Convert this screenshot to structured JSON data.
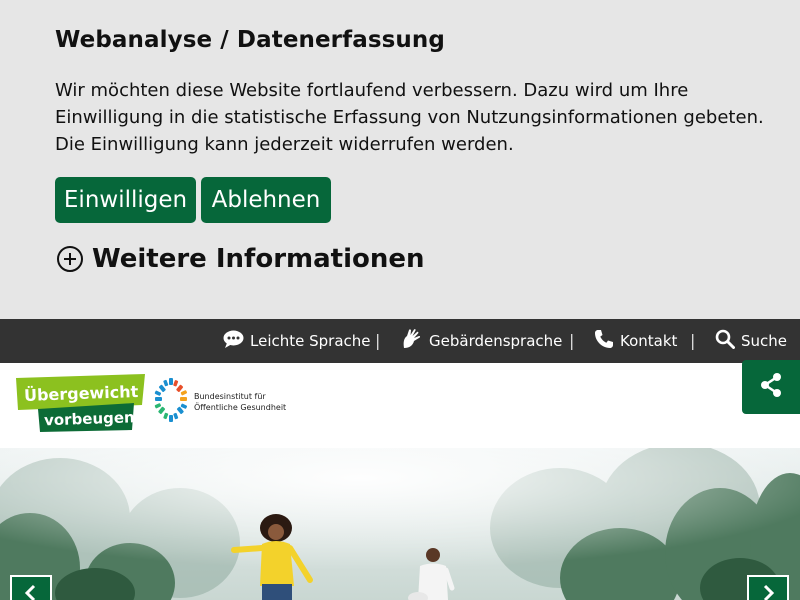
{
  "consent": {
    "title": "Webanalyse / Datenerfassung",
    "text_line1": "Wir möchten diese Website fortlaufend verbessern. Dazu wird um Ihre",
    "text_line2": "Einwilligung in die statistische Erfassung von Nutzungsinformationen gebeten.",
    "text_line3": "Die Einwilligung kann jederzeit widerrufen werden.",
    "accept_label": "Einwilligen",
    "decline_label": "Ablehnen",
    "more_info_label": "Weitere Informationen"
  },
  "utility_nav": {
    "easy_language": "Leichte Sprache",
    "sign_language": "Gebärdensprache",
    "contact": "Kontakt",
    "search": "Suche",
    "separator": "|"
  },
  "header": {
    "logo_line1": "Übergewicht",
    "logo_line2": "vorbeugen",
    "institute_line1": "Bundesinstitut für",
    "institute_line2": "Öffentliche Gesundheit"
  },
  "colors": {
    "brand_green": "#06673a",
    "logo_lime": "#8cc11f",
    "banner_bg": "#e6e6e6",
    "utility_bg": "#333333"
  },
  "icons": {
    "easy_language": "speech-bubble-icon",
    "sign_language": "sign-language-hands-icon",
    "contact": "phone-icon",
    "search": "search-icon",
    "share": "share-icon",
    "more_info": "plus-circle-icon",
    "prev": "chevron-left-icon",
    "next": "chevron-right-icon"
  }
}
